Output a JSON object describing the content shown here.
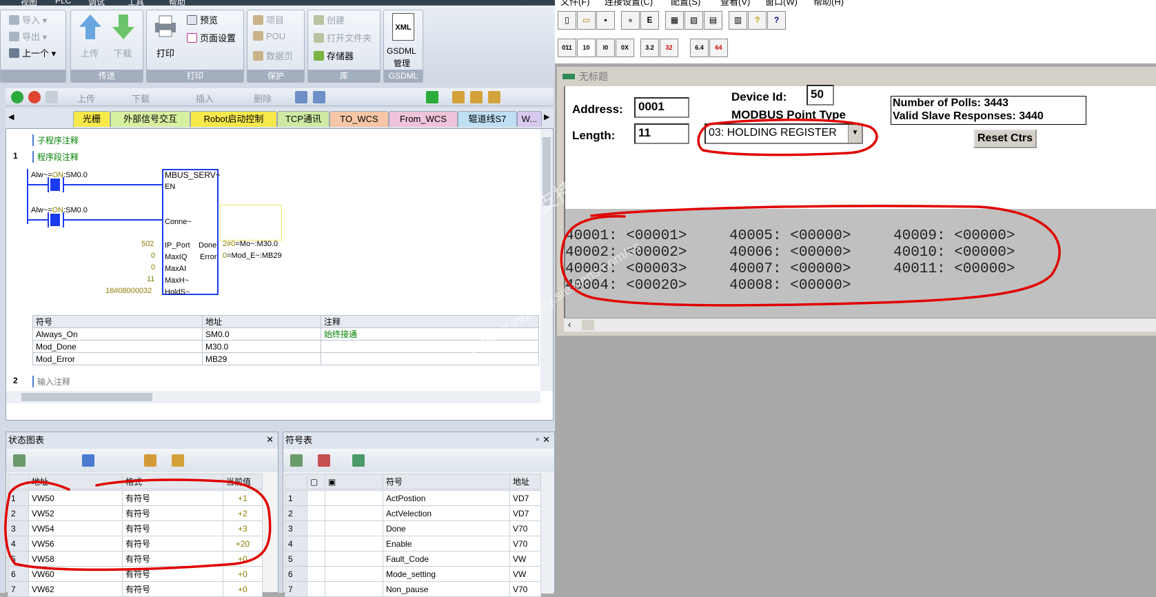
{
  "left": {
    "menubar": [
      "视图",
      "PLC",
      "调试",
      "工具",
      "帮助"
    ],
    "ribbon": {
      "file_items": [
        "导入",
        "导出",
        "上一个"
      ],
      "transfer": {
        "upload": "上传",
        "download": "下载",
        "group": "传送"
      },
      "print": {
        "print": "打印",
        "preview": "预览",
        "page_setup": "页面设置",
        "group": "打印"
      },
      "protect": {
        "project": "项目",
        "pou": "POU",
        "datapage": "数据页",
        "group": "保护"
      },
      "library": {
        "create": "创建",
        "open_folder": "打开文件夹",
        "memory": "存储器",
        "group": "库"
      },
      "gsdml": {
        "xml": "XML",
        "label1": "GSDML",
        "label2": "管理",
        "group": "GSDML"
      }
    },
    "toolbar2": {
      "upload": "上传",
      "download": "下载",
      "insert": "插入",
      "delete": "删除"
    },
    "tabs": [
      "光栅",
      "外部信号交互",
      "Robot启动控制",
      "TCP通讯",
      "TO_WCS",
      "From_WCS",
      "辊道线S7",
      "W..."
    ],
    "editor": {
      "subroutine_comment": "子程序注释",
      "network1_num": "1",
      "network1_comment": "程序段注释",
      "contact1_label_a": "Alw~=",
      "contact1_label_b": "ON",
      "contact1_label_c": ":SM0.0",
      "contact2_label_a": "Alw~=",
      "contact2_label_b": "ON",
      "contact2_label_c": ":SM0.0",
      "block_name": "MBUS_SERV~",
      "pin_en": "EN",
      "pin_conn": "Conne~",
      "pin_ip_port": "IP_Port",
      "pin_maxiq": "MaxIQ",
      "pin_maxai": "MaxAI",
      "pin_maxh": "MaxH~",
      "pin_holds": "HoldS~",
      "pin_done": "Done",
      "pin_error": "Error",
      "in_ip_port": "502",
      "in_maxiq": "0",
      "in_maxai": "0",
      "in_maxh": "11",
      "in_holds": "16#08000032",
      "out_done_val": "2#0",
      "out_done_sym": "=Mo~:M30.0",
      "out_error_val": "0",
      "out_error_sym": "=Mod_E~:MB29",
      "sym_headers": [
        "符号",
        "地址",
        "注释"
      ],
      "sym_rows": [
        [
          "Always_On",
          "SM0.0",
          "始终接通"
        ],
        [
          "Mod_Done",
          "M30.0",
          ""
        ],
        [
          "Mod_Error",
          "MB29",
          ""
        ]
      ],
      "network2_num": "2",
      "network2_comment": "输入注释"
    },
    "status_chart": {
      "title": "状态图表",
      "headers": [
        "",
        "地址",
        "格式",
        "当前值"
      ],
      "rows": [
        [
          "1",
          "VW50",
          "有符号",
          "+1"
        ],
        [
          "2",
          "VW52",
          "有符号",
          "+2"
        ],
        [
          "3",
          "VW54",
          "有符号",
          "+3"
        ],
        [
          "4",
          "VW56",
          "有符号",
          "+20"
        ],
        [
          "5",
          "VW58",
          "有符号",
          "+0"
        ],
        [
          "6",
          "VW60",
          "有符号",
          "+0"
        ],
        [
          "7",
          "VW62",
          "有符号",
          "+0"
        ]
      ]
    },
    "symbol_table": {
      "title": "符号表",
      "headers": [
        "",
        "",
        "",
        "符号",
        "地址"
      ],
      "rows": [
        [
          "1",
          "ActPostion",
          "VD7"
        ],
        [
          "2",
          "ActVelection",
          "VD7"
        ],
        [
          "3",
          "Done",
          "V70"
        ],
        [
          "4",
          "Enable",
          "V70"
        ],
        [
          "5",
          "Fault_Code",
          "VW"
        ],
        [
          "6",
          "Mode_setting",
          "VW"
        ],
        [
          "7",
          "Non_pause",
          "V70"
        ]
      ]
    }
  },
  "right": {
    "menubar": [
      "文件(F)",
      "连接设置(C)",
      "配置(S)",
      "查看(V)",
      "窗口(W)",
      "帮助(H)"
    ],
    "toolbar_row2": [
      "011",
      "10",
      "I0",
      "0X",
      "3.2",
      "32",
      "6.4",
      "64"
    ],
    "child_title": "无标题",
    "address_label": "Address:",
    "address_value": "0001",
    "length_label": "Length:",
    "length_value": "11",
    "device_id_label": "Device Id:",
    "device_id_value": "50",
    "point_type_label": "MODBUS Point Type",
    "point_type_value": "03: HOLDING REGISTER",
    "polls": "Number of Polls: 3443",
    "responses": "Valid Slave Responses: 3440",
    "reset_button": "Reset Ctrs",
    "registers": [
      "40001: <00001>",
      "40002: <00002>",
      "40003: <00003>",
      "40004: <00020>",
      "40005: <00000>",
      "40006: <00000>",
      "40007: <00000>",
      "40008: <00000>",
      "40009: <00000>",
      "40010: <00000>",
      "40011: <00000>"
    ],
    "watermark1": "西门子工业支持中心",
    "watermark2": "support.industry.siemens.com/cs"
  },
  "colors": {
    "annotation_red": "#e00000",
    "ladder_blue": "#1a3cf0",
    "comment_green": "#008000"
  }
}
